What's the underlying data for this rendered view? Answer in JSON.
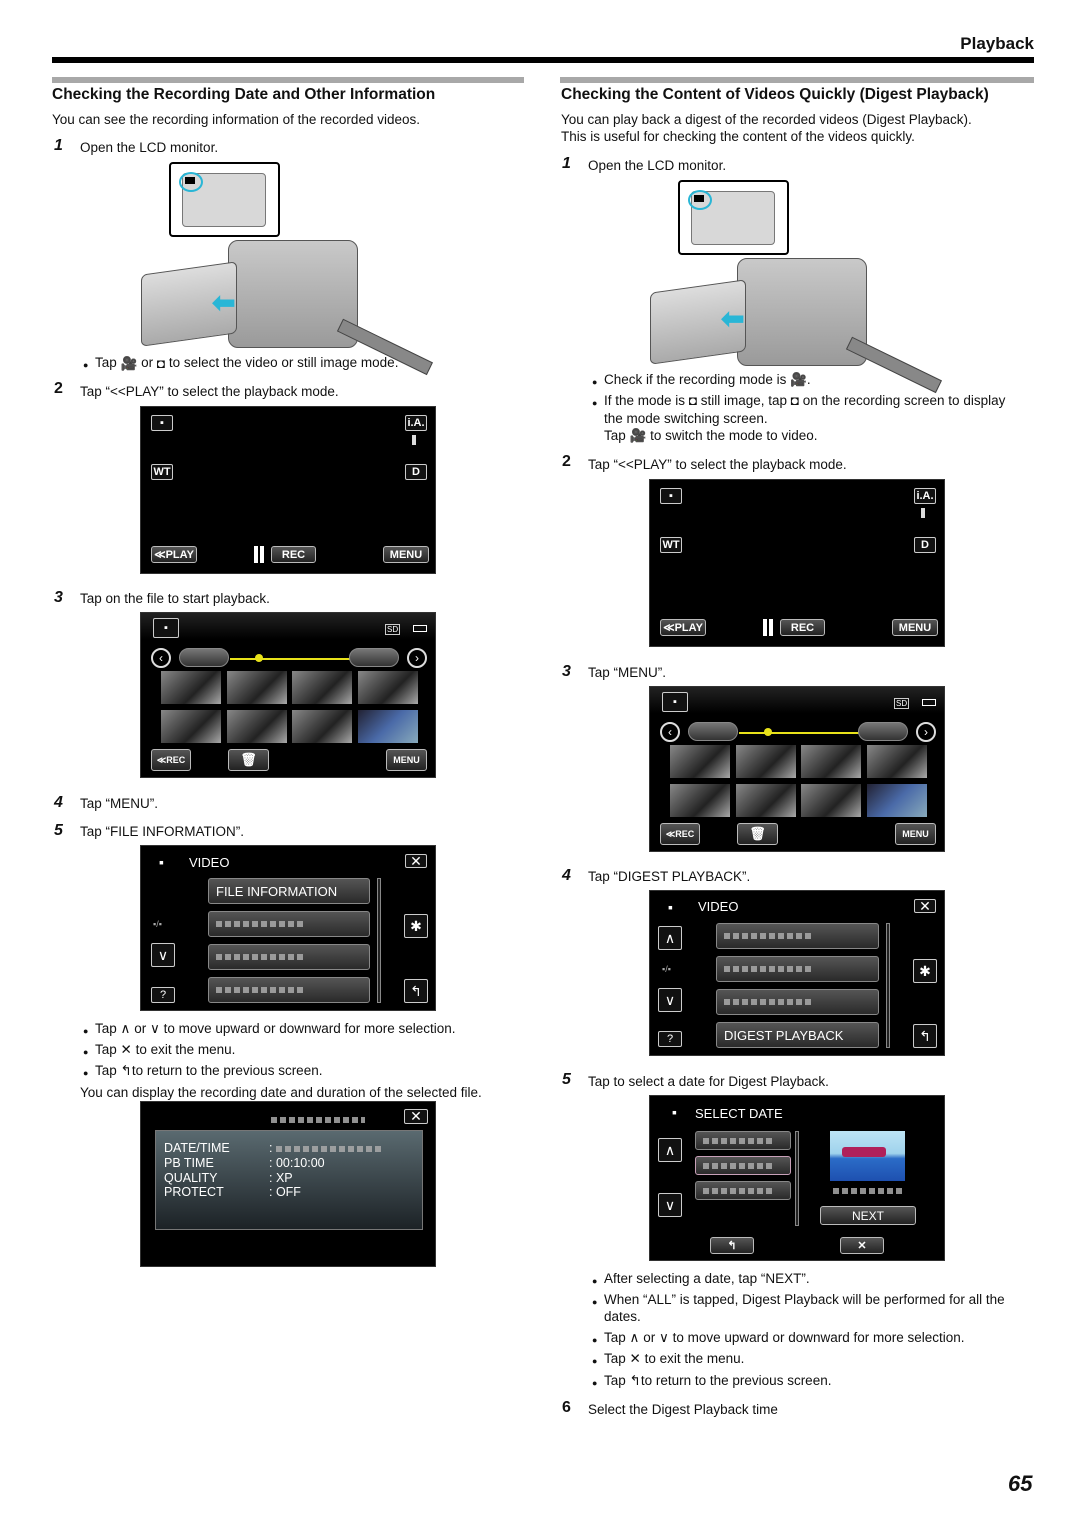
{
  "header": {
    "section": "Playback",
    "page_number": "65"
  },
  "left": {
    "title": "Checking the Recording Date and Other Information",
    "intro": "You can see the recording information of the recorded videos.",
    "steps": [
      {
        "num": "1",
        "text": "Open the LCD monitor."
      },
      {
        "num": "2",
        "text": "Tap “<<PLAY” to select the playback mode."
      },
      {
        "num": "3",
        "text": "Tap on the file to start playback."
      },
      {
        "num": "4",
        "text": "Tap “MENU”."
      },
      {
        "num": "5",
        "text": "Tap “FILE INFORMATION”."
      }
    ],
    "bullet_mode": {
      "pre": "Tap",
      "mid": "or",
      "post": "to select the video or still image mode."
    },
    "bullets_menu": [
      {
        "pre": "Tap",
        "mid": "or",
        "post": "to move upward or downward for more selection."
      },
      {
        "pre": "Tap",
        "post": "to exit the menu."
      },
      {
        "pre": "Tap",
        "post": "to return to the previous screen."
      }
    ],
    "display_note": "You can display the recording date and duration of the selected file.",
    "menu_screen": {
      "title": "VIDEO",
      "items": [
        "FILE INFORMATION",
        "",
        "",
        ""
      ],
      "help": "?"
    },
    "info_screen": {
      "rows": [
        {
          "label": "DATE/TIME",
          "value": ""
        },
        {
          "label": "PB TIME",
          "value": "00:10:00"
        },
        {
          "label": "QUALITY",
          "value": "XP"
        },
        {
          "label": "PROTECT",
          "value": "OFF"
        }
      ]
    }
  },
  "right": {
    "title": "Checking the Content of Videos Quickly (Digest Playback)",
    "intro_lines": [
      "You can play back a digest of the recorded videos (Digest Playback).",
      "This is useful for checking the content of the videos quickly."
    ],
    "steps": [
      {
        "num": "1",
        "text": "Open the LCD monitor."
      },
      {
        "num": "2",
        "text": "Tap “<<PLAY” to select the playback mode."
      },
      {
        "num": "3",
        "text": "Tap “MENU”."
      },
      {
        "num": "4",
        "text": "Tap “DIGEST PLAYBACK”."
      },
      {
        "num": "5",
        "text": "Tap to select a date for Digest Playback."
      },
      {
        "num": "6",
        "text": "Select the Digest Playback time"
      }
    ],
    "bullets_mode": {
      "check": {
        "pre": "Check if the recording mode is",
        "post": "."
      },
      "if_still": {
        "pre": "If the mode is",
        "mid": "still image, tap",
        "post": "on the recording screen to display"
      },
      "line2": "the mode switching screen.",
      "line3": {
        "pre": "Tap",
        "post": "to switch the mode to video."
      }
    },
    "menu_screen": {
      "title": "VIDEO",
      "items": [
        "",
        "",
        "",
        "DIGEST PLAYBACK"
      ],
      "help": "?"
    },
    "date_screen": {
      "title": "SELECT DATE",
      "next": "NEXT"
    },
    "bullets_after": [
      "After selecting a date, tap “NEXT”.",
      "When “ALL” is tapped, Digest Playback will be performed for all the",
      "dates."
    ],
    "bullets_menu": [
      {
        "pre": "Tap",
        "mid": "or",
        "post": "to move upward or downward for more selection."
      },
      {
        "pre": "Tap",
        "post": "to exit the menu."
      },
      {
        "pre": "Tap",
        "post": "to return to the previous screen."
      }
    ]
  },
  "rec_screen": {
    "ia": "i.A.",
    "wt": "WT",
    "d": "D",
    "play": "≪PLAY",
    "rec": "REC",
    "menu": "MENU"
  },
  "index_screen": {
    "sd": "SD",
    "rec": "≪REC",
    "menu": "MENU"
  },
  "accent": {
    "highlight_circle": "#29b6d6",
    "timeline": "#e8e21a"
  }
}
